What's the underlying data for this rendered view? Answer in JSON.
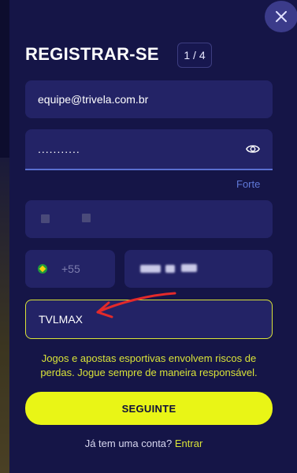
{
  "header": {
    "title": "REGISTRAR-SE",
    "step": "1 / 4"
  },
  "form": {
    "email_value": "equipe@trivela.com.br",
    "password_value": "...........",
    "password_strength": "Forte",
    "country_code": "+55",
    "promo_value": "TVLMAX"
  },
  "notice": {
    "text": "Jogos e apostas esportivas envolvem riscos de perdas. Jogue sempre de maneira responsável."
  },
  "actions": {
    "next_label": "SEGUINTE",
    "have_account": "Já tem uma conta?",
    "login_link": "Entrar"
  },
  "colors": {
    "background": "#151547",
    "field": "#232366",
    "accent_yellow": "#e9f516",
    "password_line": "#5a6fd0",
    "annotation_arrow": "#e32a2a"
  },
  "icons": {
    "close": "close-icon",
    "eye": "eye-icon",
    "flag": "brazil-flag-icon"
  }
}
